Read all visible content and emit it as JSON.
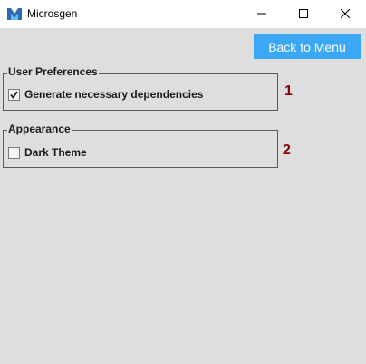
{
  "window": {
    "title": "Microsgen",
    "icon": "microsgen-logo-icon",
    "controls": [
      "minimize-icon",
      "maximize-icon",
      "close-icon"
    ]
  },
  "toolbar": {
    "back_label": "Back to Menu"
  },
  "user_preferences": {
    "title": "User Preferences",
    "generate_dependencies": {
      "label": "Generate necessary dependencies",
      "checked": true
    }
  },
  "appearance": {
    "title": "Appearance",
    "dark_theme": {
      "label": "Dark Theme",
      "checked": false
    }
  },
  "annotations": {
    "marker_1": "1",
    "marker_2": "2"
  },
  "colors": {
    "accent": "#3aa8f7",
    "background": "#dedede",
    "annotation": "#8b0000"
  }
}
